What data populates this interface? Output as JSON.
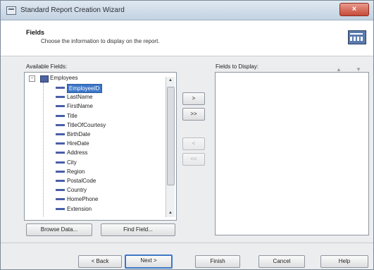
{
  "window": {
    "title": "Standard Report Creation Wizard",
    "close_label": "×"
  },
  "header": {
    "title": "Fields",
    "subtitle": "Choose the information to display on the report."
  },
  "available": {
    "label": "Available Fields:",
    "root": {
      "expander": "−",
      "label": "Employees"
    },
    "fields": [
      {
        "name": "EmployeeID",
        "selected": true
      },
      {
        "name": "LastName"
      },
      {
        "name": "FirstName"
      },
      {
        "name": "Title"
      },
      {
        "name": "TitleOfCourtesy"
      },
      {
        "name": "BirthDate"
      },
      {
        "name": "HireDate"
      },
      {
        "name": "Address"
      },
      {
        "name": "City"
      },
      {
        "name": "Region"
      },
      {
        "name": "PostalCode"
      },
      {
        "name": "Country"
      },
      {
        "name": "HomePhone"
      },
      {
        "name": "Extension"
      }
    ]
  },
  "transfer": {
    "add": ">",
    "add_all": ">>",
    "remove": "<",
    "remove_all": "<<"
  },
  "display": {
    "label": "Fields to Display:",
    "up": "▲",
    "down": "▼"
  },
  "buttons": {
    "browse": "Browse Data...",
    "find": "Find Field..."
  },
  "footer": {
    "back": "< Back",
    "next": "Next >",
    "finish": "Finish",
    "cancel": "Cancel",
    "help": "Help"
  }
}
